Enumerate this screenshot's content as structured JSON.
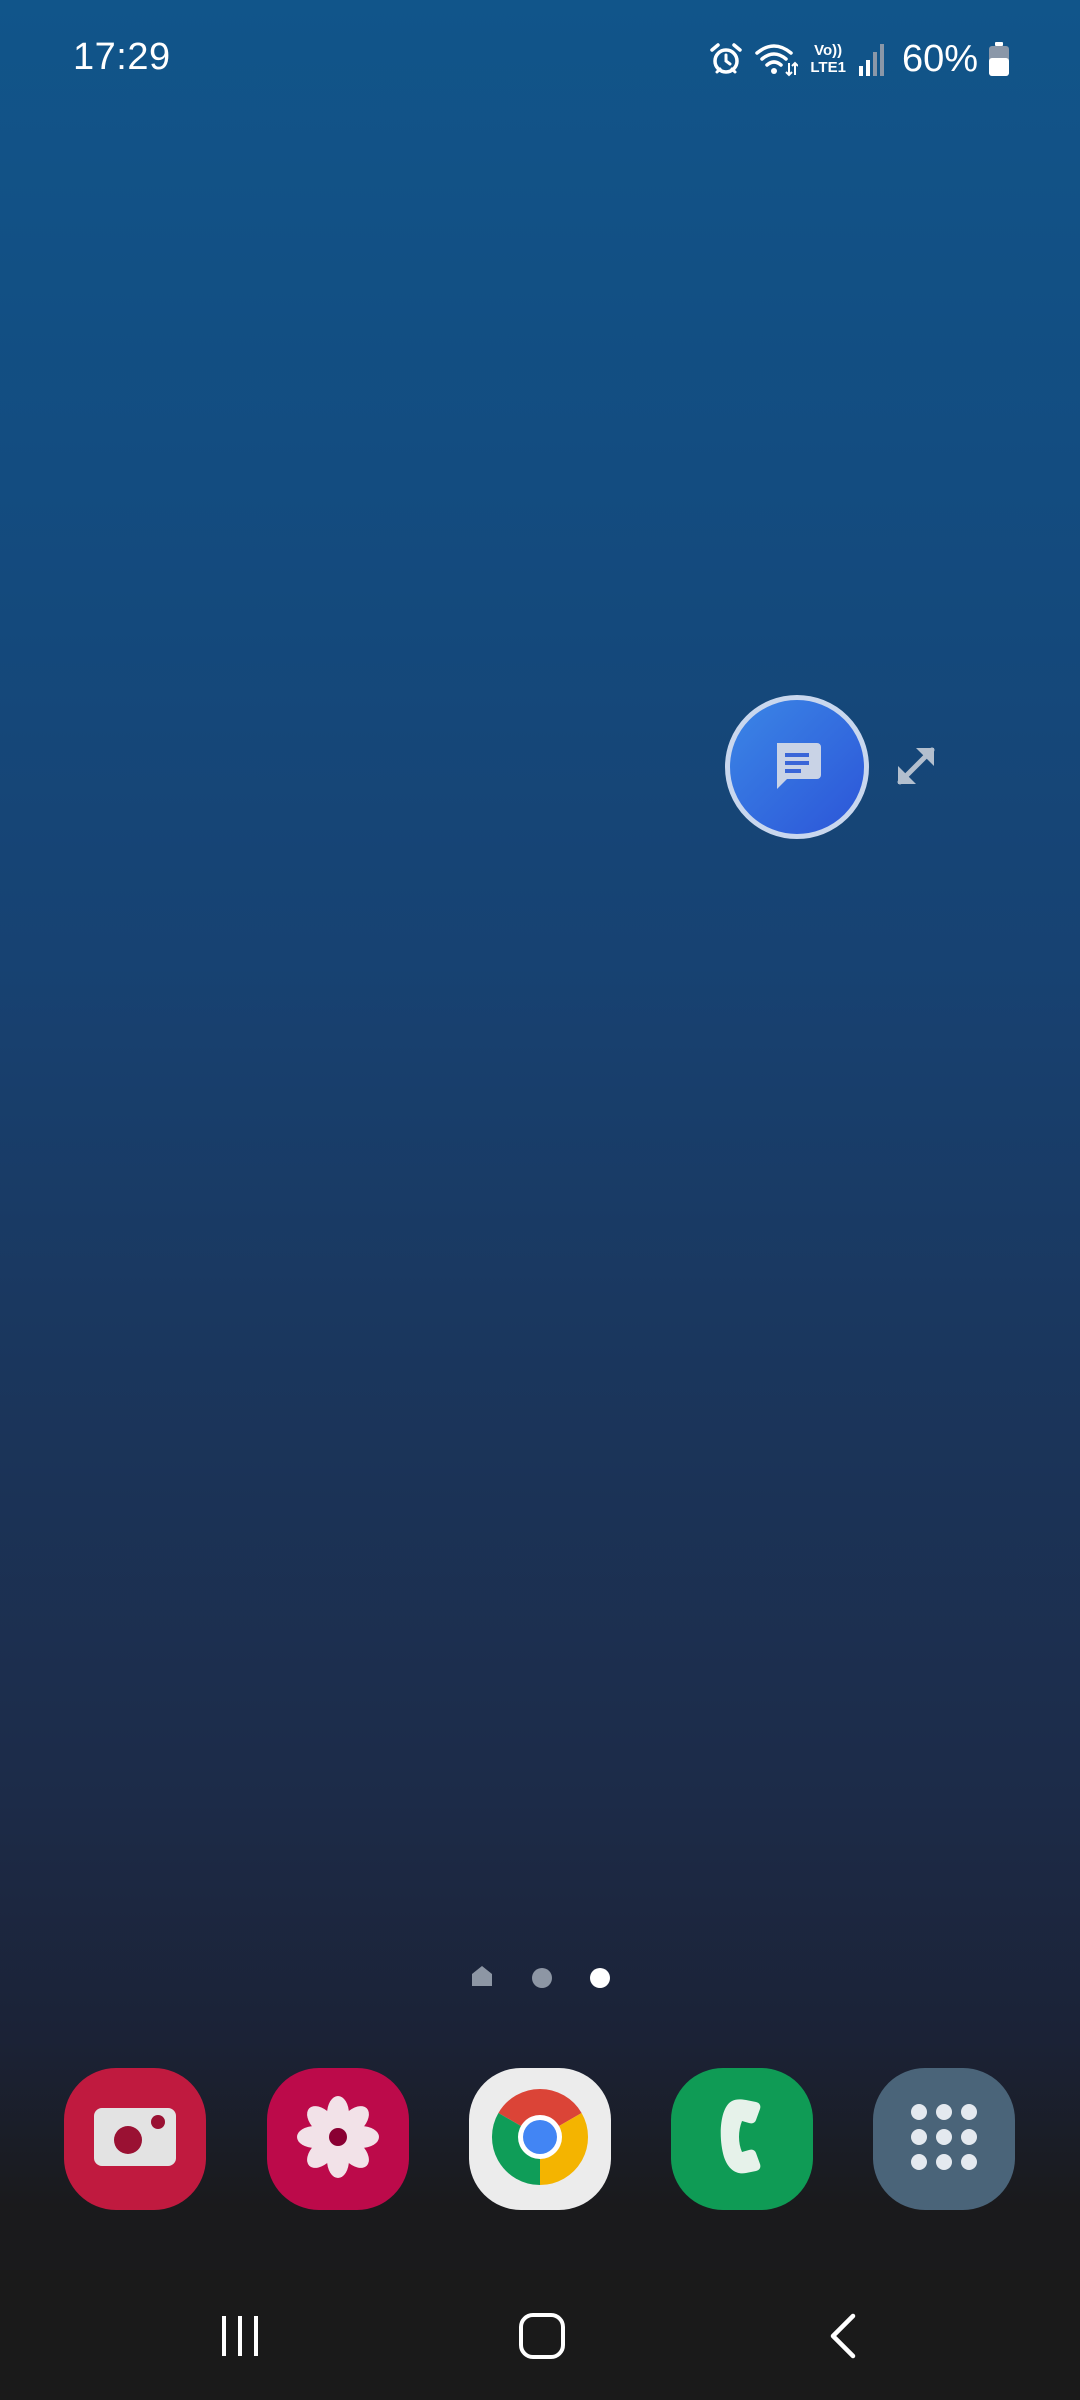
{
  "status_bar": {
    "time": "17:29",
    "volte_top": "Vo))",
    "volte_bottom": "LTE1",
    "battery_percent": "60%",
    "icons": [
      "alarm-icon",
      "wifi-icon",
      "volte-icon",
      "signal-icon",
      "battery-icon"
    ]
  },
  "floating_bubble": {
    "icon": "message-icon",
    "expand_icon": "expand-icon"
  },
  "page_indicator": {
    "pages": [
      "home",
      "page",
      "page"
    ],
    "active_index": 2
  },
  "dock": {
    "apps": [
      {
        "icon": "camera-icon",
        "color": "#c01a3f"
      },
      {
        "icon": "gallery-icon",
        "color": "#bc0a4a"
      },
      {
        "icon": "chrome-icon",
        "color": "#ececec"
      },
      {
        "icon": "phone-icon",
        "color": "#0f9b55"
      },
      {
        "icon": "app-drawer-icon",
        "color": "#4a6479"
      }
    ]
  },
  "nav_bar": {
    "buttons": [
      "recents-icon",
      "home-icon",
      "back-icon"
    ]
  },
  "colors": {
    "wallpaper_top": "#11558a",
    "wallpaper_bottom": "#1a1a1c",
    "bubble": "#2f6ae0"
  }
}
